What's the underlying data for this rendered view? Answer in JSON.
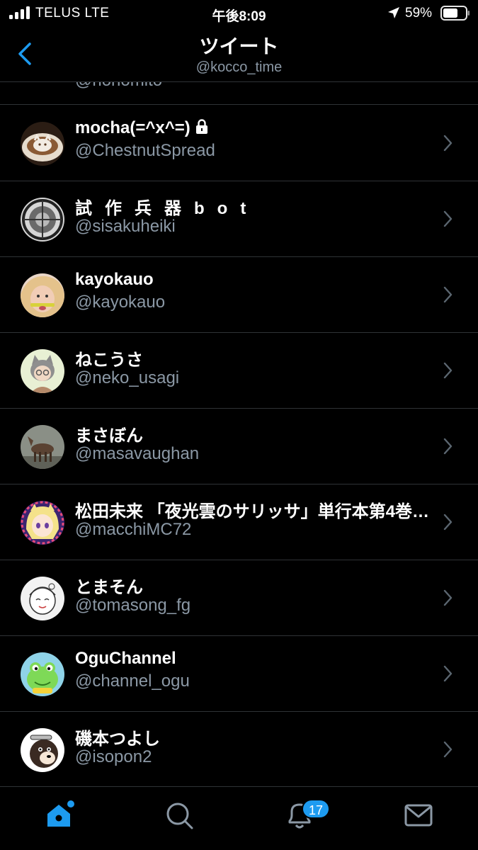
{
  "status_bar": {
    "carrier": "TELUS  LTE",
    "time": "午後8:09",
    "battery": "59%"
  },
  "header": {
    "title": "ツイート",
    "subtitle": "@kocco_time"
  },
  "partial_row": {
    "handle": "@nonomito"
  },
  "users": [
    {
      "name": "mocha(=^x^=)",
      "handle": "@ChestnutSpread",
      "locked": true
    },
    {
      "name": "試作兵器bot",
      "handle": "@sisakuheiki"
    },
    {
      "name": "kayokauo",
      "handle": "@kayokauo"
    },
    {
      "name": "ねこうさ",
      "handle": "@neko_usagi"
    },
    {
      "name": "まさぼん",
      "handle": "@masavaughan"
    },
    {
      "name": "松田未来 「夜光雲のサリッサ」単行本第4巻…",
      "handle": "@macchiMC72"
    },
    {
      "name": "とまそん",
      "handle": "@tomasong_fg"
    },
    {
      "name": "OguChannel",
      "handle": "@channel_ogu"
    },
    {
      "name": "磯本つよし",
      "handle": "@isopon2"
    }
  ],
  "tabbar": {
    "tabs": [
      "home-icon",
      "search-icon",
      "bell-icon",
      "mail-icon"
    ],
    "notification_count": "17"
  },
  "colors": {
    "accent": "#1d9bf0",
    "secondary_text": "#8b98a5",
    "divider": "#2f3336"
  }
}
